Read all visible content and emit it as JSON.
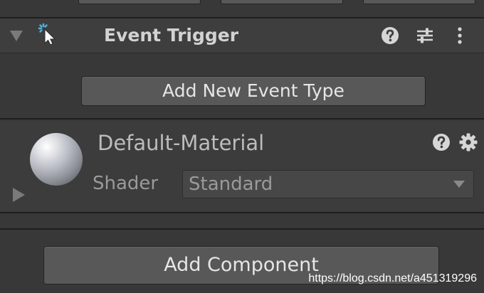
{
  "event_trigger": {
    "title": "Event Trigger",
    "icons": [
      "foldout-arrow-icon",
      "event-trigger-icon",
      "help-icon",
      "preset-sliders-icon",
      "more-vertical-icon"
    ],
    "add_event_button": "Add New Event Type"
  },
  "material": {
    "name": "Default-Material",
    "shader_label": "Shader",
    "shader_value": "Standard",
    "icons": [
      "material-sphere-preview",
      "foldout-arrow-icon",
      "help-icon",
      "gear-icon",
      "dropdown-arrow-icon"
    ]
  },
  "add_component_button": "Add Component",
  "watermark": "https://blog.csdn.net/a451319296",
  "colors": {
    "background": "#383838",
    "header_background": "#3e3e3e",
    "button": "#585858",
    "text": "#d2d2d2",
    "accent_icon": "#4fb4e6"
  }
}
